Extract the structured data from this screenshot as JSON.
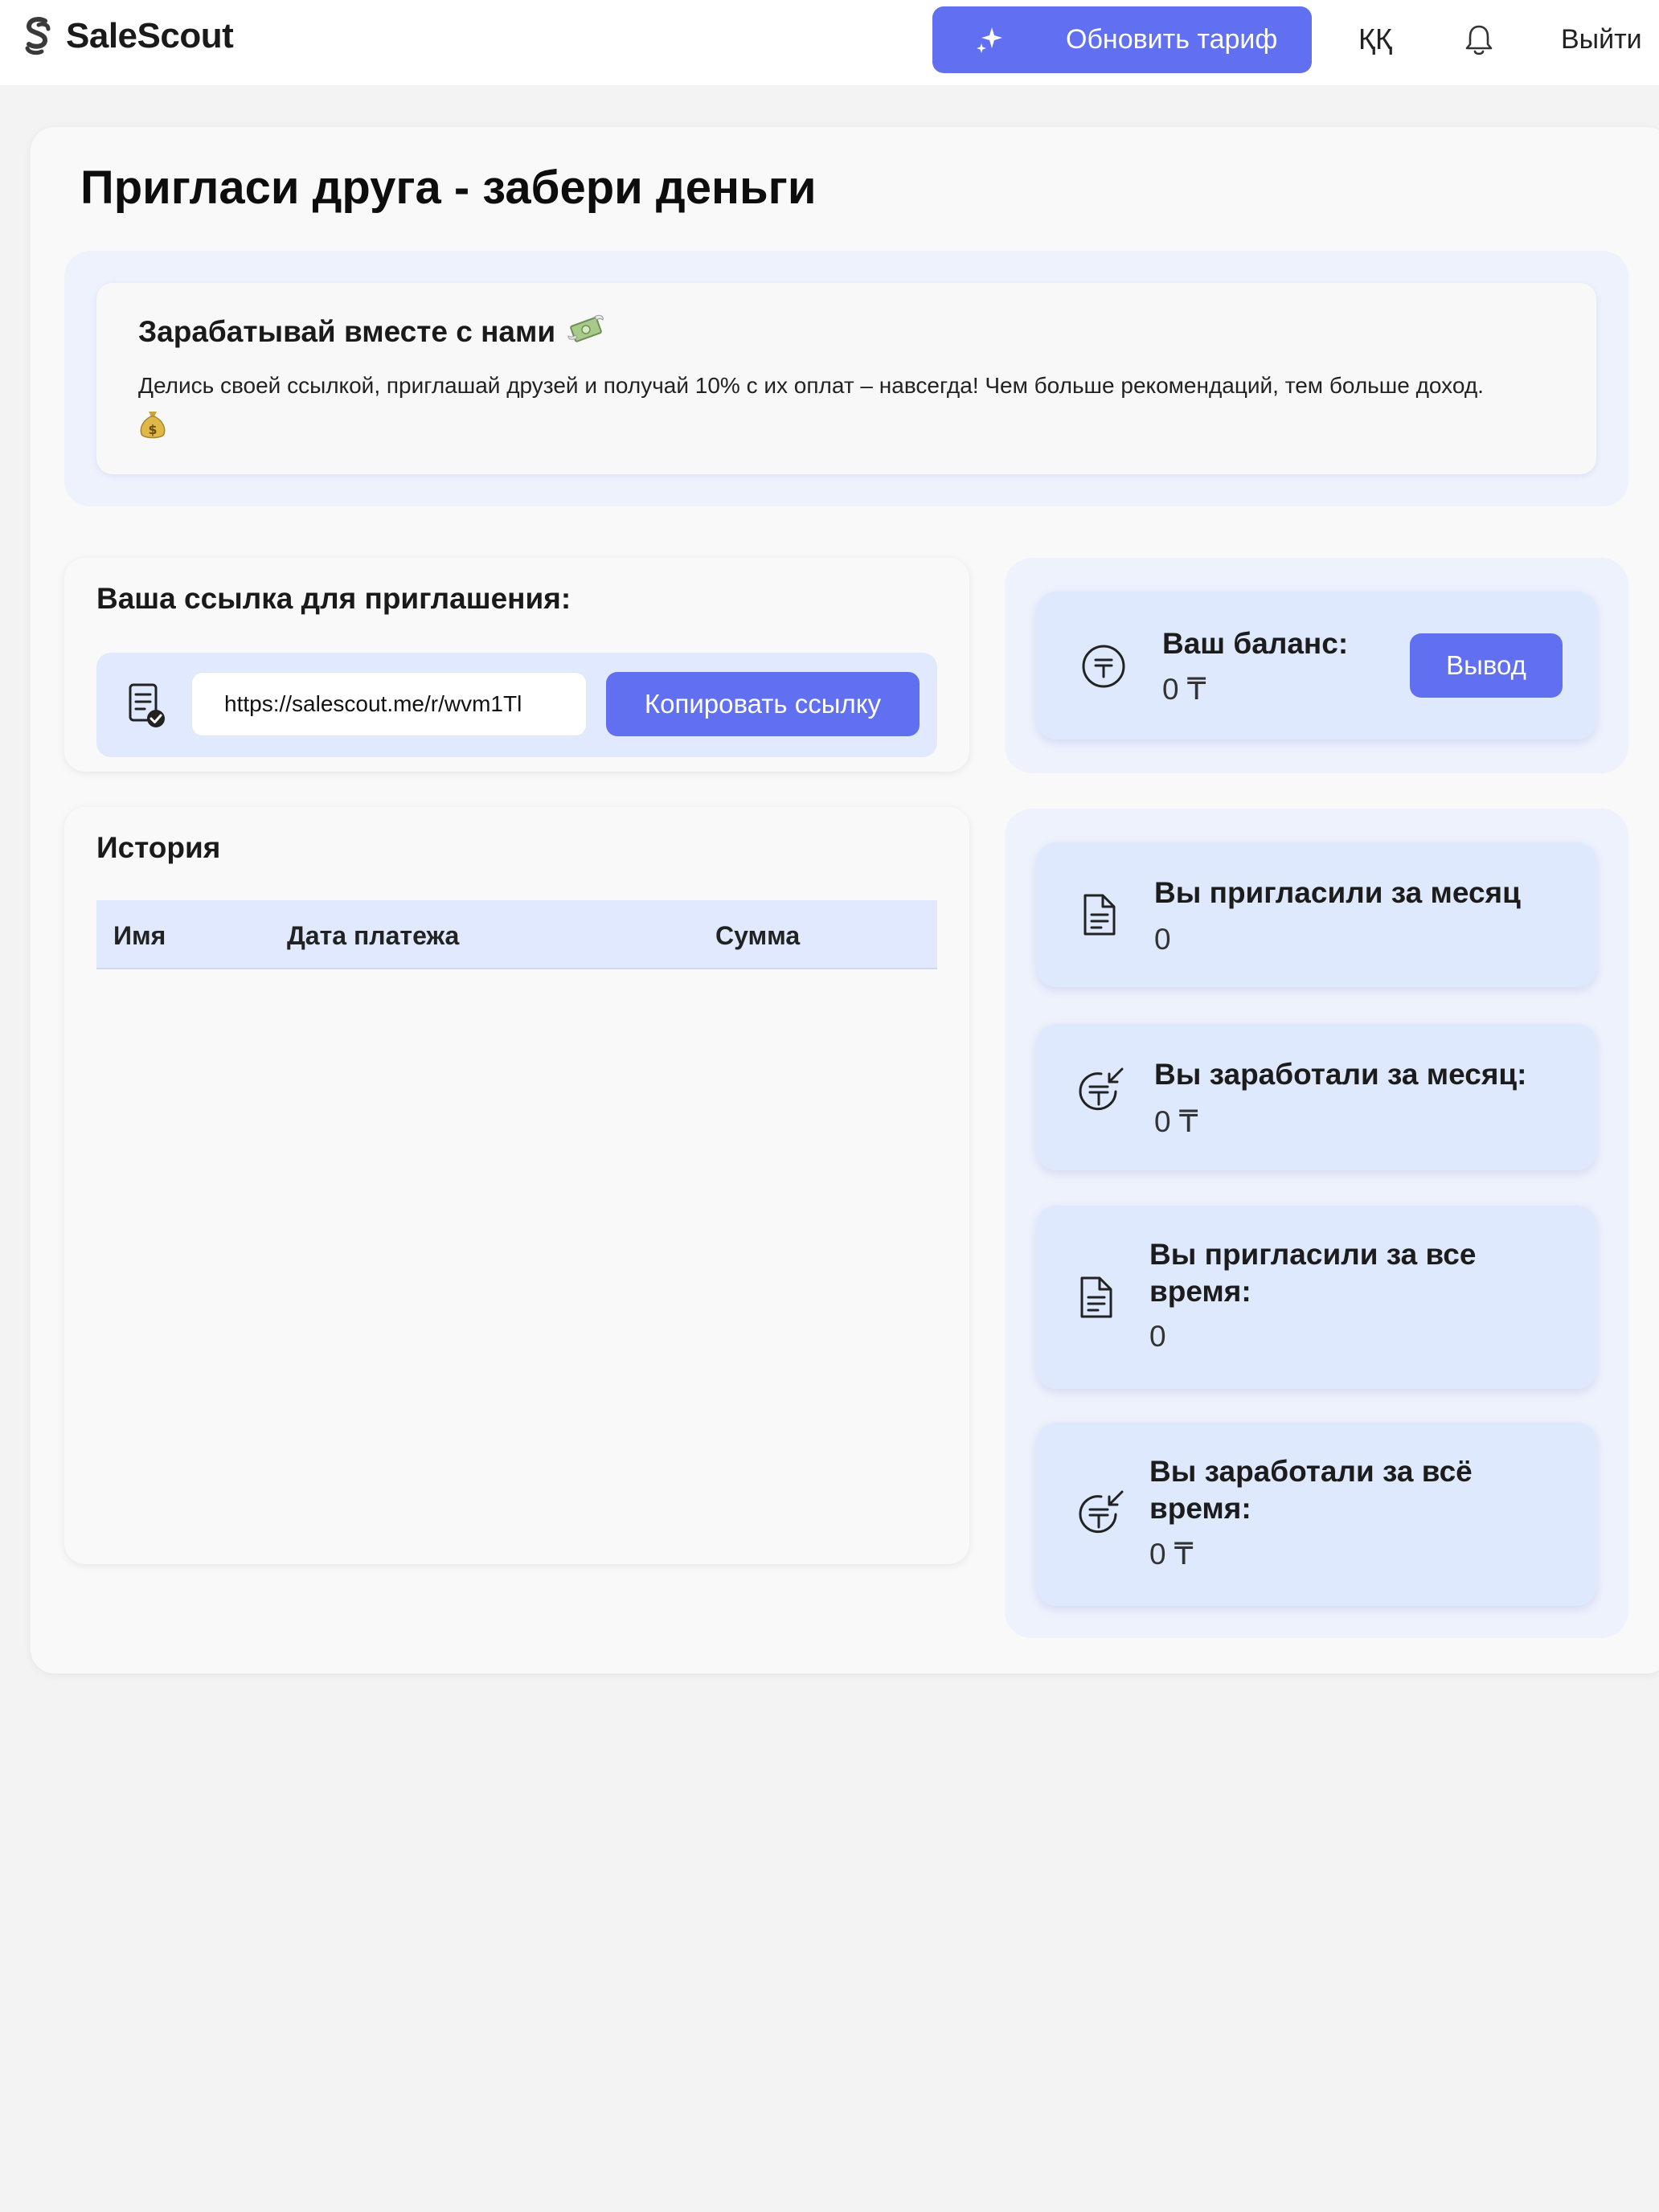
{
  "header": {
    "logo_text": "SaleScout",
    "upgrade_label": "Обновить тариф",
    "language": "ҚҚ",
    "logout_label": "Выйти"
  },
  "page": {
    "title": "Пригласи друга - забери деньги"
  },
  "promo": {
    "title": "Зарабатывай вместе с нами",
    "text": "Делись своей ссылкой, приглашай друзей и получай 10% с их оплат – навсегда! Чем больше рекомендаций, тем больше доход."
  },
  "invite": {
    "title": "Ваша ссылка для приглашения:",
    "link_value": "https://salescout.me/r/wvm1Tl",
    "copy_label": "Копировать ссылку"
  },
  "history": {
    "title": "История",
    "columns": [
      "Имя",
      "Дата платежа",
      "Сумма"
    ],
    "rows": []
  },
  "balance": {
    "label": "Ваш баланс:",
    "value": "0 ₸",
    "withdraw_label": "Вывод"
  },
  "stats": [
    {
      "label": "Вы пригласили за месяц",
      "value": "0",
      "icon": "document-icon"
    },
    {
      "label": "Вы заработали за месяц:",
      "value": "0 ₸",
      "icon": "tenge-income-icon"
    },
    {
      "label": "Вы пригласили за все время:",
      "value": "0",
      "icon": "document-icon"
    },
    {
      "label": "Вы заработали за всё время:",
      "value": "0 ₸",
      "icon": "tenge-income-icon"
    }
  ],
  "colors": {
    "accent": "#6170f0",
    "panel_bg": "#eef2fd",
    "card_bg": "#dfe9fd",
    "page_bg": "#f3f3f4"
  }
}
